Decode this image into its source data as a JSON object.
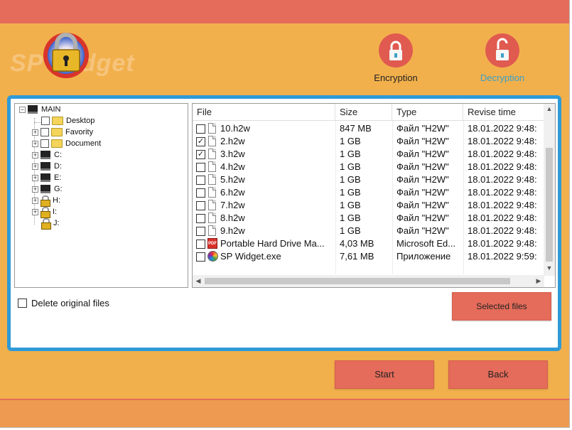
{
  "app": {
    "logo_text": "SP Widget"
  },
  "modes": {
    "encryption_label": "Encryption",
    "decryption_label": "Decryption"
  },
  "tree": {
    "root": "MAIN",
    "items": [
      {
        "label": "Desktop",
        "type": "folder"
      },
      {
        "label": "Favority",
        "type": "folder"
      },
      {
        "label": "Document",
        "type": "folder"
      },
      {
        "label": "C:",
        "type": "drive"
      },
      {
        "label": "D:",
        "type": "drive"
      },
      {
        "label": "E:",
        "type": "drive"
      },
      {
        "label": "G:",
        "type": "drive"
      },
      {
        "label": "H:",
        "type": "locked-drive"
      },
      {
        "label": "I:",
        "type": "locked-drive"
      },
      {
        "label": "J:",
        "type": "locked-drive"
      }
    ]
  },
  "files": {
    "columns": [
      "File",
      "Size",
      "Type",
      "Revise time"
    ],
    "rows": [
      {
        "name": "10.h2w",
        "size": "847 MB",
        "type": "Файл \"H2W\"",
        "time": "18.01.2022 9:48:",
        "checked": false,
        "icon": "doc"
      },
      {
        "name": "2.h2w",
        "size": "1 GB",
        "type": "Файл \"H2W\"",
        "time": "18.01.2022 9:48:",
        "checked": true,
        "icon": "doc"
      },
      {
        "name": "3.h2w",
        "size": "1 GB",
        "type": "Файл \"H2W\"",
        "time": "18.01.2022 9:48:",
        "checked": true,
        "icon": "doc"
      },
      {
        "name": "4.h2w",
        "size": "1 GB",
        "type": "Файл \"H2W\"",
        "time": "18.01.2022 9:48:",
        "checked": false,
        "icon": "doc"
      },
      {
        "name": "5.h2w",
        "size": "1 GB",
        "type": "Файл \"H2W\"",
        "time": "18.01.2022 9:48:",
        "checked": false,
        "icon": "doc"
      },
      {
        "name": "6.h2w",
        "size": "1 GB",
        "type": "Файл \"H2W\"",
        "time": "18.01.2022 9:48:",
        "checked": false,
        "icon": "doc"
      },
      {
        "name": "7.h2w",
        "size": "1 GB",
        "type": "Файл \"H2W\"",
        "time": "18.01.2022 9:48:",
        "checked": false,
        "icon": "doc"
      },
      {
        "name": "8.h2w",
        "size": "1 GB",
        "type": "Файл \"H2W\"",
        "time": "18.01.2022 9:48:",
        "checked": false,
        "icon": "doc"
      },
      {
        "name": "9.h2w",
        "size": "1 GB",
        "type": "Файл \"H2W\"",
        "time": "18.01.2022 9:48:",
        "checked": false,
        "icon": "doc"
      },
      {
        "name": "Portable Hard Drive Ma...",
        "size": "4,03 MB",
        "type": "Microsoft Ed...",
        "time": "18.01.2022 9:48:",
        "checked": false,
        "icon": "pdf"
      },
      {
        "name": "SP Widget.exe",
        "size": "7,61 MB",
        "type": "Приложение",
        "time": "18.01.2022 9:59:",
        "checked": false,
        "icon": "exe"
      }
    ]
  },
  "options": {
    "delete_original_label": "Delete original files",
    "delete_original_checked": false
  },
  "buttons": {
    "selected_files": "Selected files",
    "start": "Start",
    "back": "Back"
  },
  "colors": {
    "background": "#f2b04c",
    "accent_red": "#e56b5a",
    "panel_border": "#2f9ad6",
    "active_mode_text": "#3aa0c8"
  }
}
